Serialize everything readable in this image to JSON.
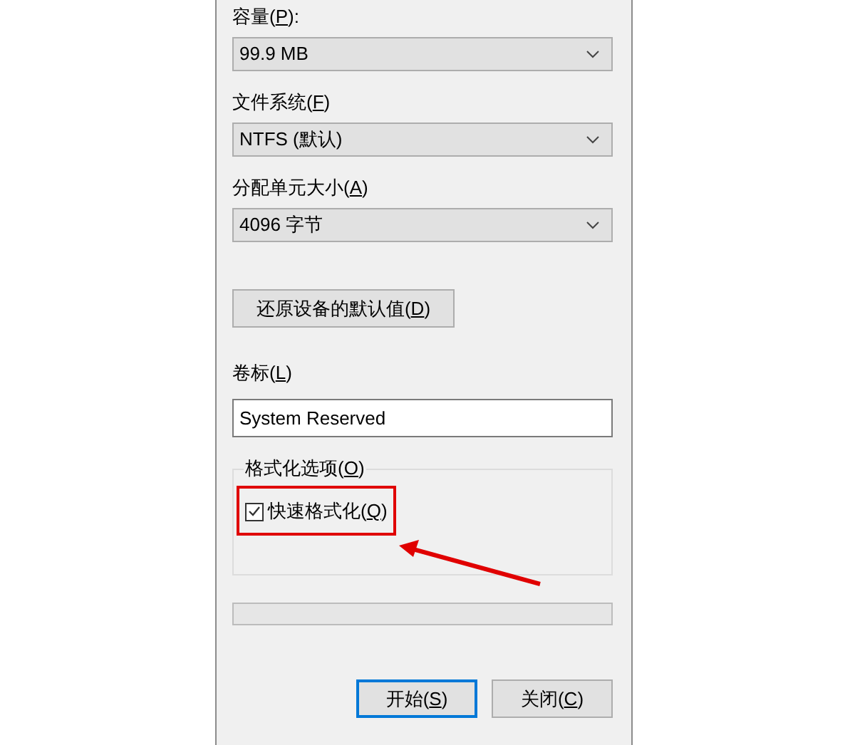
{
  "capacity": {
    "label": [
      "容量(",
      "P",
      "):"
    ],
    "value": "99.9 MB"
  },
  "file_system": {
    "label": [
      "文件系统(",
      "F",
      ")"
    ],
    "value": "NTFS (默认)"
  },
  "allocation_unit": {
    "label": [
      "分配单元大小(",
      "A",
      ")"
    ],
    "value": "4096 字节"
  },
  "restore_button": [
    "还原设备的默认值(",
    "D",
    ")"
  ],
  "volume_label": {
    "label": [
      "卷标(",
      "L",
      ")"
    ],
    "value": "System Reserved"
  },
  "format_options": {
    "title": [
      "格式化选项(",
      "O",
      ")"
    ],
    "options": [
      {
        "label": [
          "快速格式化(",
          "Q",
          ")"
        ],
        "checked": true,
        "highlighted": true
      }
    ]
  },
  "buttons": [
    {
      "label": [
        "开始(",
        "S",
        ")"
      ],
      "default": true
    },
    {
      "label": [
        "关闭(",
        "C",
        ")"
      ],
      "default": false
    }
  ]
}
